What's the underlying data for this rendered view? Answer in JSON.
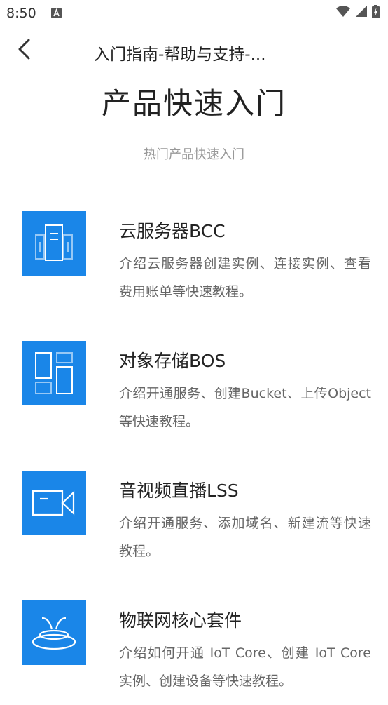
{
  "status_bar": {
    "time": "8:50"
  },
  "nav": {
    "title": "入门指南-帮助与支持-..."
  },
  "header": {
    "title": "产品快速入门",
    "subtitle": "热门产品快速入门"
  },
  "products": [
    {
      "name": "云服务器BCC",
      "desc": "介绍云服务器创建实例、连接实例、查看费用账单等快速教程。",
      "icon": "server-icon"
    },
    {
      "name": "对象存储BOS",
      "desc": "介绍开通服务、创建Bucket、上传Object等快速教程。",
      "icon": "storage-blocks-icon"
    },
    {
      "name": "音视频直播LSS",
      "desc": "介绍开通服务、添加域名、新建流等快速教程。",
      "icon": "video-camera-icon"
    },
    {
      "name": "物联网核心套件",
      "desc": "介绍如何开通 IoT Core、创建 IoT Core 实例、创建设备等快速教程。",
      "icon": "iot-signal-icon"
    }
  ],
  "colors": {
    "icon_background": "#1a86e8",
    "title_text": "#222222",
    "desc_text": "#666666",
    "subtitle_text": "#999999"
  }
}
